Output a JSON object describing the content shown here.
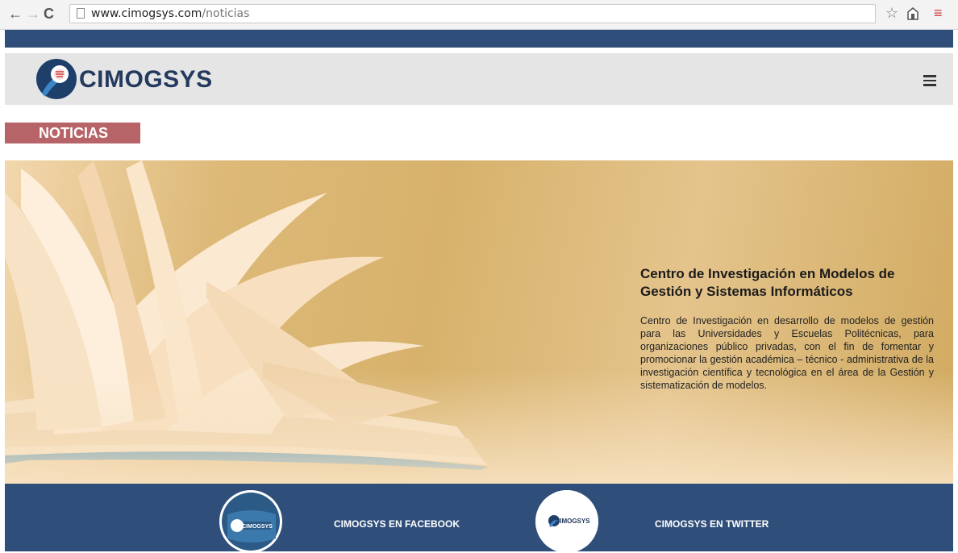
{
  "browser": {
    "url_host": "www.cimogsys.com",
    "url_path": "/noticias",
    "back_icon": "←",
    "forward_icon": "→",
    "reload_icon": "C",
    "star_icon": "☆",
    "menu_icon": "≡"
  },
  "site": {
    "brand": "CIMOGSYS",
    "section_title": "NOTICIAS",
    "hero": {
      "title": "Centro de Investigación en Modelos de Gestión y Sistemas Informáticos",
      "description": "Centro de Investigación en desarrollo de modelos de gestión para las Universidades y Escuelas Politécnicas, para organizaciones público privadas, con el fin de fomentar y promocionar la gestión académica – técnico - administrativa de la investigación científica y tecnológica en el área de la Gestión y sistematización de modelos."
    },
    "footer": {
      "facebook_label": "CIMOGSYS EN FACEBOOK",
      "twitter_label": "CIMOGSYS EN TWITTER",
      "fb_badge_text": "CIMOGSYS",
      "tw_badge_text": "CIMOGSYS"
    }
  },
  "colors": {
    "navy": "#2f4f7a",
    "section_label_bg": "#b76469",
    "header_bg": "#e5e5e5"
  }
}
